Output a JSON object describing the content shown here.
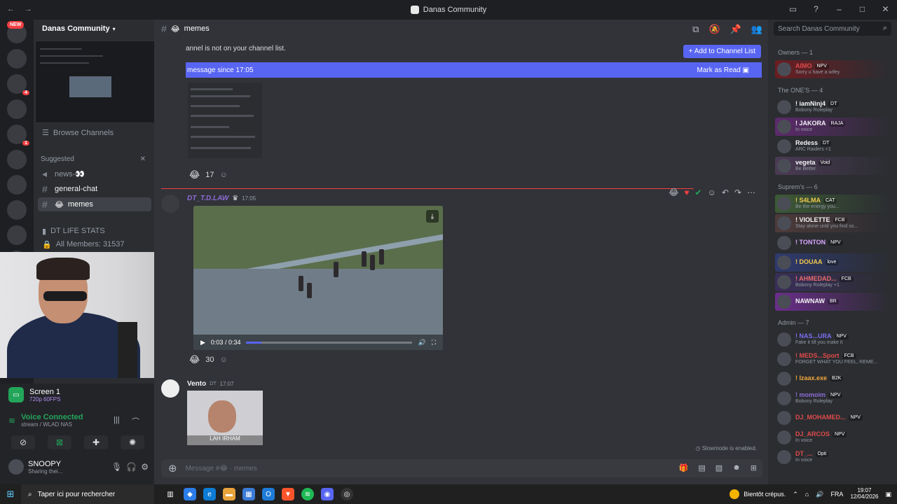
{
  "window": {
    "title": "Danas Community",
    "nav": [
      "←",
      "→"
    ]
  },
  "servers": {
    "new_label": "NEW",
    "badges": [
      "4",
      "1",
      "15",
      "5"
    ]
  },
  "sidebar": {
    "server_name": "Danas Community",
    "browse_label": "Browse Channels",
    "suggested_label": "Suggested",
    "channels": [
      {
        "label": "news-👀"
      },
      {
        "label": "general-chat"
      },
      {
        "label": "memes"
      }
    ],
    "stats_category": "DT LIFE STATS",
    "stats_item": "All Members: 31537"
  },
  "voice_panel": {
    "screen_title": "Screen 1",
    "screen_sub": "720p 60FPS",
    "status": "Voice Connected",
    "status_sub": "stream / WLAD NAS",
    "user_name": "SNOOPY",
    "user_status": "Sharing thei..."
  },
  "header": {
    "channel": "memes",
    "notice": "annel is not on your channel list.",
    "add_button": "Add to Channel List",
    "new_messages": "message since 17:05",
    "mark_read": "Mark as Read"
  },
  "messages": [
    {
      "reaction_count": "17"
    },
    {
      "author": "DT_T.D.LAW",
      "time": "17:05",
      "video_time": "0:03 / 0:34",
      "video_progress": 0.09,
      "reaction_count": "30"
    },
    {
      "author": "Vento",
      "tag": "DT",
      "time": "17:07",
      "caption": "LAH IRHAM"
    }
  ],
  "slowmode": "Slowmode is enabled.",
  "composer": {
    "placeholder": "Message #😂 · memes"
  },
  "members": {
    "search_placeholder": "Search Danas Community",
    "groups": [
      {
        "label": "Owners — 1",
        "items": [
          {
            "name": "AIMO",
            "tag": "NPV",
            "status": "Sorry u have a wifey",
            "color": "#e04b4b",
            "bg": "#6b1d22"
          }
        ]
      },
      {
        "label": "The ONE'S — 4",
        "items": [
          {
            "name": "! iamNinj4",
            "tag": "DT",
            "status": "Bobony Roleplay",
            "color": "#f2f3f5",
            "bg": "transparent"
          },
          {
            "name": "! JAKORA",
            "tag": "RAJA",
            "status": "In voice",
            "color": "#f2f3f5",
            "bg": "#5d2a6d"
          },
          {
            "name": "Redess",
            "tag": "DT",
            "status": "ARC Raiders +1",
            "color": "#f2f3f5",
            "bg": "transparent"
          },
          {
            "name": "vegeta",
            "tag": "Void",
            "status": "Be Better.",
            "color": "#f2f3f5",
            "bg": "#4a3a55"
          }
        ]
      },
      {
        "label": "Suprem's — 6",
        "items": [
          {
            "name": "! S4LMA",
            "tag": "CAT",
            "status": "Be the energy you...",
            "color": "#f2c94c",
            "bg": "#3c5a35"
          },
          {
            "name": "! VIOLETTE",
            "tag": "FCB",
            "status": "Stay alone until you find so...",
            "color": "#f2f3f5",
            "bg": "#4d3a3a"
          },
          {
            "name": "! TONTON",
            "tag": "NPV",
            "status": "",
            "color": "#d9a6ff",
            "bg": "transparent"
          },
          {
            "name": "! DOUAA",
            "tag": "love",
            "status": "",
            "color": "#f2c94c",
            "bg": "#2e3a6e"
          },
          {
            "name": "! AHMEDAD...",
            "tag": "FCB",
            "status": "Bobony Roleplay +1",
            "color": "#e86b6b",
            "bg": "#3a2e5a"
          },
          {
            "name": "NAWNAW",
            "tag": "BR",
            "status": "",
            "color": "#f2f3f5",
            "bg": "#6a2d8a"
          }
        ]
      },
      {
        "label": "Admin — 7",
        "items": [
          {
            "name": "! NAS...URA",
            "tag": "NPV",
            "status": "Fake it till you make it",
            "color": "#7a6ff0",
            "bg": "transparent"
          },
          {
            "name": "! MEDS...Sport",
            "tag": "FCB",
            "status": "FORGET WHAT YOU FEEL, REME...",
            "color": "#e04b4b",
            "bg": "transparent"
          },
          {
            "name": "! Izaax.exe",
            "tag": "B2K",
            "status": "",
            "color": "#f2a73b",
            "bg": "transparent"
          },
          {
            "name": "! momoim",
            "tag": "NPV",
            "status": "Bobony Roleplay",
            "color": "#8e6bd6",
            "bg": "transparent"
          },
          {
            "name": "DJ_MOHAMED...",
            "tag": "NPV",
            "status": "",
            "color": "#e04b4b",
            "bg": "transparent"
          },
          {
            "name": "DJ_ARCOS",
            "tag": "NPV",
            "status": "In voice",
            "color": "#e04b4b",
            "bg": "transparent"
          },
          {
            "name": "DT_...",
            "tag": "Opti",
            "status": "In voice",
            "color": "#e04b4b",
            "bg": "transparent"
          }
        ]
      }
    ]
  },
  "taskbar": {
    "search_placeholder": "Taper ici pour rechercher",
    "weather": "Bientôt crépus.",
    "lang": "FRA",
    "time": "19:07",
    "date": "12/04/2026"
  }
}
